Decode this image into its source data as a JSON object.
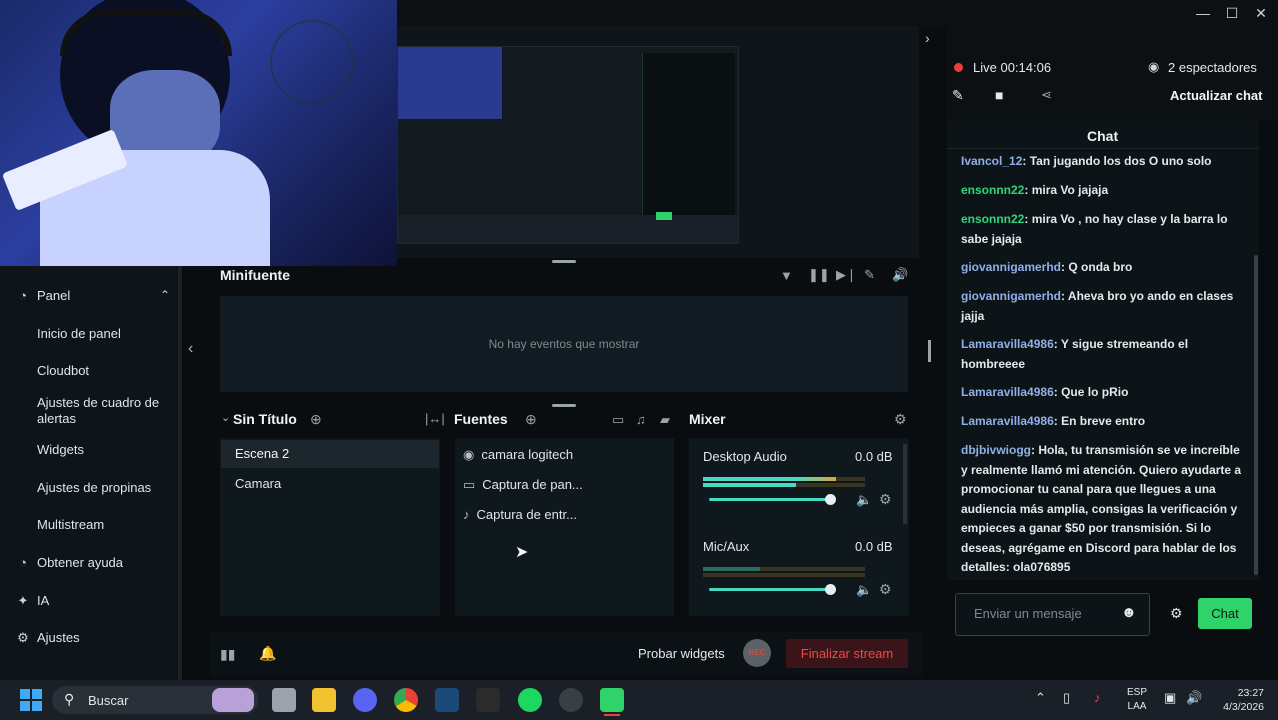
{
  "window": {
    "minimize": "—",
    "maximize": "☐",
    "close": "✕"
  },
  "preview": {
    "expand_icon": "chevron-right"
  },
  "sidebar": {
    "panel": "Panel",
    "items": [
      "Inicio de panel",
      "Cloudbot",
      "Ajustes de cuadro de alertas",
      "Widgets",
      "Ajustes de propinas",
      "Multistream"
    ],
    "help": "Obtener ayuda",
    "ia": "IA",
    "settings": "Ajustes"
  },
  "minifuente": {
    "title": "Minifuente",
    "empty": "No hay eventos que mostrar"
  },
  "scenes": {
    "title": "Sin Título",
    "items": [
      "Escena 2",
      "Camara"
    ],
    "selected": 0
  },
  "sources": {
    "title": "Fuentes",
    "items": [
      "camara logitech",
      "Captura de pan...",
      "Captura de entr..."
    ]
  },
  "mixer": {
    "title": "Mixer",
    "channels": [
      {
        "name": "Desktop Audio",
        "db": "0.0 dB",
        "level": 0.82,
        "volume": 1.0
      },
      {
        "name": "Mic/Aux",
        "db": "0.0 dB",
        "level": 0.35,
        "volume": 1.0
      }
    ]
  },
  "bottom": {
    "test_widgets": "Probar widgets",
    "rec": "REC",
    "end_stream": "Finalizar stream"
  },
  "stream": {
    "live": "Live",
    "time": "00:14:06",
    "viewers": "2 espectadores",
    "refresh_chat": "Actualizar chat"
  },
  "chat": {
    "title": "Chat",
    "messages": [
      {
        "user": "Ivancol_12",
        "text": "Tan jugando los dos O uno solo"
      },
      {
        "user": "ensonnn22",
        "text": "mira Vo jajaja"
      },
      {
        "user": "ensonnn22",
        "text": "mira Vo , no hay clase y la barra lo sabe jajaja"
      },
      {
        "user": "giovannigamerhd",
        "text": "Q onda bro"
      },
      {
        "user": "giovannigamerhd",
        "text": "Aheva bro yo ando en clases jajja"
      },
      {
        "user": "Lamaravilla4986",
        "text": "Y sigue stremeando el hombreeee"
      },
      {
        "user": "Lamaravilla4986",
        "text": "Que lo pRio"
      },
      {
        "user": "Lamaravilla4986",
        "text": "En breve entro"
      },
      {
        "user": "dbjbivwiogg",
        "text": "Hola, tu transmisión se ve increíble y realmente llamó mi atención. Quiero ayudarte a promocionar tu canal para que llegues a una audiencia más amplia, consigas la verificación y empieces a ganar $50 por transmisión. Si lo deseas, agrégame en Discord para hablar de los detalles: ola076895"
      }
    ],
    "placeholder": "Enviar un mensaje",
    "send": "Chat"
  },
  "taskbar": {
    "search": "Buscar",
    "lang1": "ESP",
    "lang2": "LAA",
    "time": "23:27",
    "date": "4/3/2026"
  }
}
